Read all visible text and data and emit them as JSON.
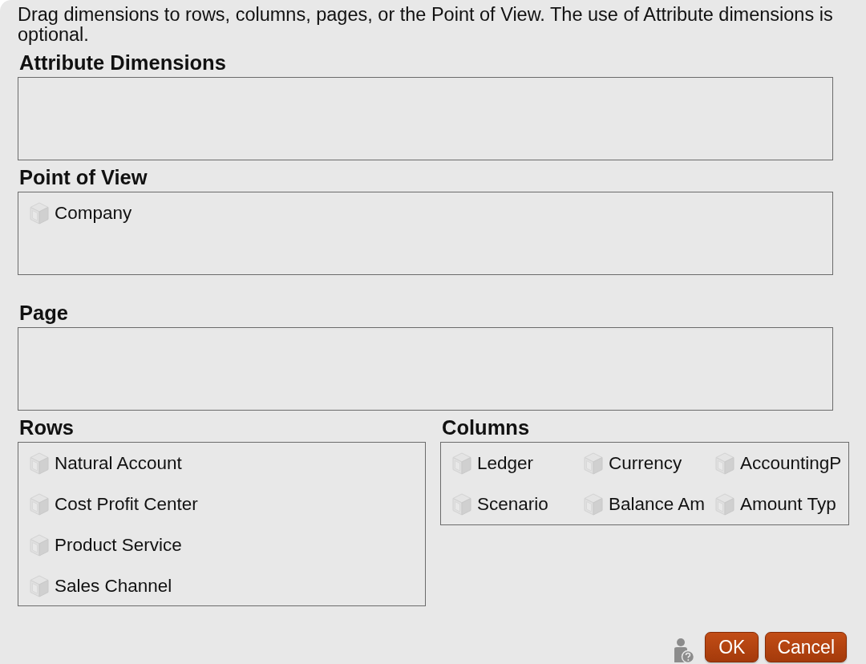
{
  "instructions": "Drag dimensions to rows, columns, pages, or the Point of View. The use of Attribute dimensions is optional.",
  "attribute_dimensions": {
    "title": "Attribute Dimensions"
  },
  "point_of_view": {
    "title": "Point of View",
    "items": [
      "Company"
    ]
  },
  "page": {
    "title": "Page"
  },
  "rows": {
    "title": "Rows",
    "items": [
      "Natural Account",
      "Cost Profit Center",
      "Product Service",
      "Sales Channel"
    ]
  },
  "columns": {
    "title": "Columns",
    "items": [
      "Ledger",
      "Currency",
      "AccountingP",
      "Scenario",
      "Balance Am",
      "Amount Typ"
    ]
  },
  "buttons": [
    "OK",
    "Cancel"
  ]
}
